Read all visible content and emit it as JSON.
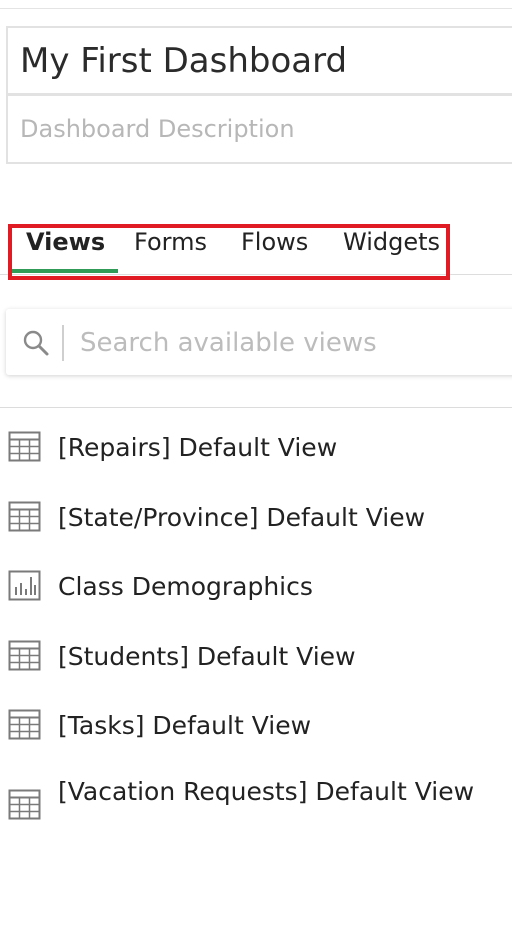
{
  "dashboard": {
    "title": "My First Dashboard",
    "description_placeholder": "Dashboard Description"
  },
  "tabs": [
    {
      "label": "Views",
      "active": true
    },
    {
      "label": "Forms",
      "active": false
    },
    {
      "label": "Flows",
      "active": false
    },
    {
      "label": "Widgets",
      "active": false
    }
  ],
  "search": {
    "placeholder": "Search available views",
    "icon": "search-icon"
  },
  "views": [
    {
      "label": "[Repairs] Default View",
      "icon": "table-icon"
    },
    {
      "label": "[State/Province] Default View",
      "icon": "table-icon"
    },
    {
      "label": "Class Demographics",
      "icon": "bar-chart-icon"
    },
    {
      "label": "[Students] Default View",
      "icon": "table-icon"
    },
    {
      "label": "[Tasks] Default View",
      "icon": "table-icon"
    },
    {
      "label": "[Vacation Requests] Default View",
      "icon": "table-icon"
    }
  ],
  "colors": {
    "active_tab_underline": "#2f9b57",
    "highlight_box": "#e01b24"
  }
}
